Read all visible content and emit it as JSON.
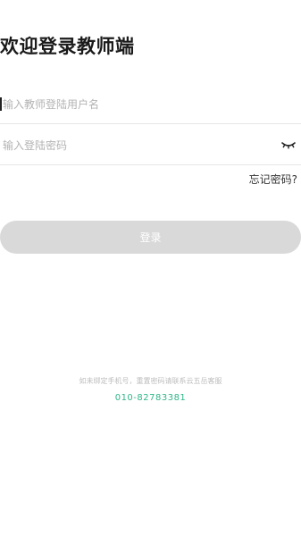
{
  "header": {
    "title": "欢迎登录教师端"
  },
  "form": {
    "username": {
      "placeholder": "输入教师登陆用户名",
      "value": ""
    },
    "password": {
      "placeholder": "输入登陆密码",
      "value": ""
    },
    "password_toggle_icon": "eye-closed-icon",
    "forgot_label": "忘记密码?",
    "login_label": "登录"
  },
  "footer": {
    "hint": "如未绑定手机号，重置密码请联系云五岳客服",
    "phone": "010-82783381"
  },
  "colors": {
    "accent": "#2fb687",
    "button_disabled": "#d9d9d9",
    "divider": "#e6e6e6",
    "placeholder": "#b3b3b3"
  }
}
